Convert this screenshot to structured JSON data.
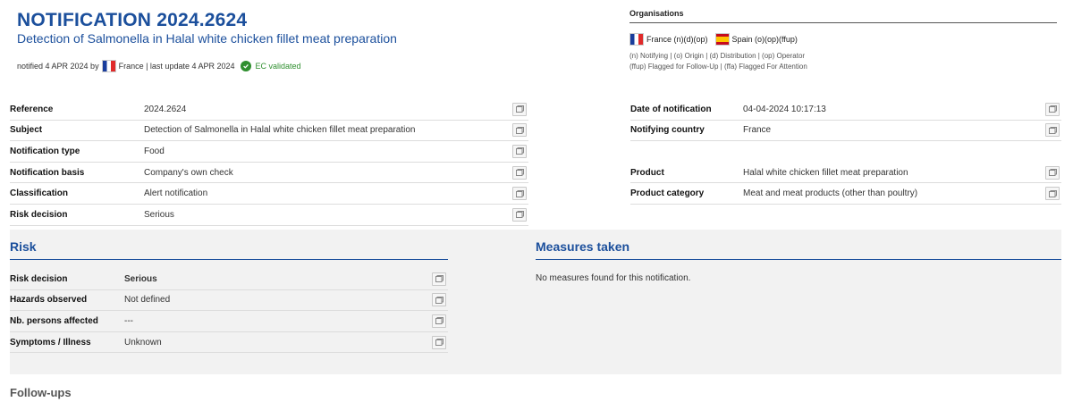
{
  "header": {
    "title": "NOTIFICATION 2024.2624",
    "subtitle": "Detection of Salmonella in Halal white chicken fillet meat preparation",
    "notified_prefix": "notified 4 APR 2024 by",
    "notified_country": "France | last update 4 APR 2024",
    "ec_status": "EC validated"
  },
  "organisations": {
    "title": "Organisations",
    "items": [
      {
        "country": "France (n)(d)(op)",
        "flag": "flag-france-icon"
      },
      {
        "country": "Spain (o)(op)(ffup)",
        "flag": "flag-spain-icon"
      }
    ],
    "legend_line1": "(n) Notifying | (o) Origin | (d) Distribution | (op) Operator",
    "legend_line2": "(ffup) Flagged for Follow-Up | (ffa) Flagged For Attention"
  },
  "details_left": [
    {
      "label": "Reference",
      "value": "2024.2624"
    },
    {
      "label": "Subject",
      "value": "Detection of Salmonella in Halal white chicken fillet meat preparation"
    },
    {
      "label": "Notification type",
      "value": "Food"
    },
    {
      "label": "Notification basis",
      "value": "Company's own check"
    },
    {
      "label": "Classification",
      "value": "Alert notification"
    },
    {
      "label": "Risk decision",
      "value": "Serious"
    }
  ],
  "details_right": [
    {
      "label": "Date of notification",
      "value": "04-04-2024 10:17:13"
    },
    {
      "label": "Notifying country",
      "value": "France"
    },
    {
      "label": "Product",
      "value": "Halal white chicken fillet meat preparation"
    },
    {
      "label": "Product category",
      "value": "Meat and meat products (other than poultry)"
    }
  ],
  "risk": {
    "title": "Risk",
    "rows": [
      {
        "label": "Risk decision",
        "value": "Serious"
      },
      {
        "label": "Hazards observed",
        "value": "Not defined"
      },
      {
        "label": "Nb. persons affected",
        "value": "---"
      },
      {
        "label": "Symptoms / Illness",
        "value": "Unknown"
      }
    ]
  },
  "measures": {
    "title": "Measures taken",
    "empty_text": "No measures found for this notification."
  },
  "followups": {
    "title": "Follow-ups"
  },
  "colors": {
    "accent": "#1b4f9c",
    "serious": "#c0272d",
    "validated": "#2f8f2f"
  }
}
